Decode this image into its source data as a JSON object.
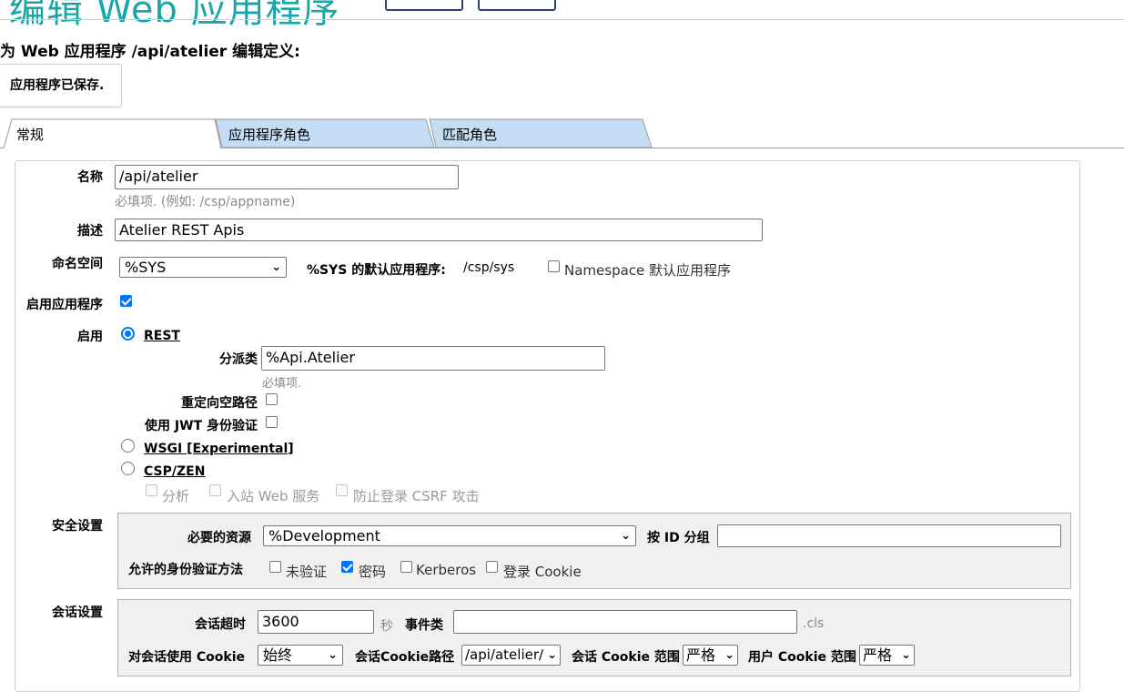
{
  "page": {
    "title": "编辑 Web 应用程序",
    "subtitle": "为 Web 应用程序 /api/atelier 编辑定义:",
    "saved_message": "应用程序已保存."
  },
  "tabs": [
    {
      "label": "常规",
      "active": true
    },
    {
      "label": "应用程序角色",
      "active": false
    },
    {
      "label": "匹配角色",
      "active": false
    }
  ],
  "general": {
    "name_label": "名称",
    "name_value": "/api/atelier",
    "name_hint": "必填项. (例如:  /csp/appname)",
    "desc_label": "描述",
    "desc_value": "Atelier REST Apis",
    "ns_label": "命名空间",
    "ns_value": "%SYS",
    "ns_default_label": "%SYS 的默认应用程序:",
    "ns_default_value": "/csp/sys",
    "ns_default_cb_label": "Namespace 默认应用程序",
    "ns_default_cb_checked": false,
    "enable_app_label": "启用应用程序",
    "enable_app_checked": true,
    "enable_label": "启用",
    "rest_label": "REST",
    "rest_selected": true,
    "dispatch_label": "分派类",
    "dispatch_value": "%Api.Atelier",
    "dispatch_hint": "必填项.",
    "redirect_label": "重定向空路径",
    "redirect_checked": false,
    "jwt_label": "使用 JWT 身份验证",
    "jwt_checked": false,
    "wsgi_label": "WSGI [Experimental]",
    "wsgi_selected": false,
    "csp_label": "CSP/ZEN",
    "csp_selected": false,
    "csp_options": [
      {
        "label": "分析",
        "checked": false,
        "disabled": true
      },
      {
        "label": "入站 Web 服务",
        "checked": false,
        "disabled": true
      },
      {
        "label": "防止登录 CSRF 攻击",
        "checked": false,
        "disabled": true
      }
    ]
  },
  "security": {
    "section_label": "安全设置",
    "resource_label": "必要的资源",
    "resource_value": "%Development",
    "group_label": "按 ID 分组",
    "group_value": "",
    "auth_label": "允许的身份验证方法",
    "auth_methods": [
      {
        "label": "未验证",
        "checked": false
      },
      {
        "label": "密码",
        "checked": true
      },
      {
        "label": "Kerberos",
        "checked": false
      },
      {
        "label": "登录 Cookie",
        "checked": false
      }
    ]
  },
  "session": {
    "section_label": "会话设置",
    "timeout_label": "会话超时",
    "timeout_value": "3600",
    "timeout_unit": "秒",
    "event_label": "事件类",
    "event_value": "",
    "event_suffix": ".cls",
    "use_cookie_label": "对会话使用 Cookie",
    "use_cookie_value": "始终",
    "cookie_path_label": "会话Cookie路径",
    "cookie_path_value": "/api/atelier/",
    "cookie_scope_label": "会话 Cookie 范围",
    "cookie_scope_value": "严格",
    "user_cookie_scope_label": "用户 Cookie 范围",
    "user_cookie_scope_value": "严格"
  },
  "colors": {
    "title": "#1aa6a6",
    "tab_inactive": "#c5dcf5",
    "checkbox_accent": "#0075ff"
  }
}
